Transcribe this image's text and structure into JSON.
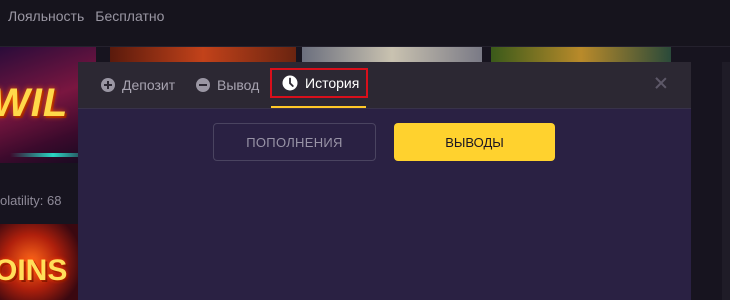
{
  "topnav": {
    "items": [
      "Лояльность",
      "Бесплатно"
    ]
  },
  "background": {
    "left_tile_word": "WIL",
    "volatility_text": "olatility: 68",
    "left_bottom_tile_word": "OINS"
  },
  "modal": {
    "tabs": [
      {
        "label": "Депозит",
        "icon": "plus-circle-icon"
      },
      {
        "label": "Вывод",
        "icon": "minus-circle-icon"
      },
      {
        "label": "История",
        "icon": "clock-icon",
        "active": true
      }
    ],
    "buttons": {
      "deposits_label": "ПОПОЛНЕНИЯ",
      "withdrawals_label": "ВЫВОДЫ"
    }
  },
  "colors": {
    "accent": "#ffd22e",
    "highlight_box": "#d80f1b",
    "modal_bg": "#2a2143"
  }
}
